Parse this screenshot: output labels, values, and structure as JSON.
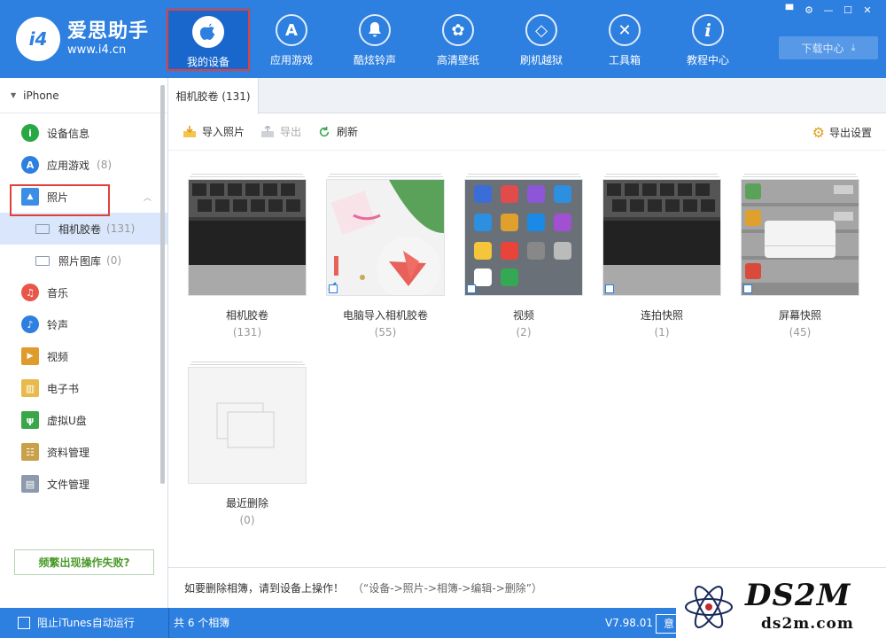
{
  "app": {
    "logo_badge": "i4",
    "logo_name": "爱思助手",
    "logo_url": "www.i4.cn"
  },
  "nav": [
    {
      "label": "我的设备",
      "icon": "apple-icon",
      "glyph": "",
      "active": true
    },
    {
      "label": "应用游戏",
      "icon": "app-store-icon",
      "glyph": "A"
    },
    {
      "label": "酷炫铃声",
      "icon": "bell-icon",
      "glyph": "♪"
    },
    {
      "label": "高清壁纸",
      "icon": "flower-icon",
      "glyph": "✿"
    },
    {
      "label": "刷机越狱",
      "icon": "dropbox-icon",
      "glyph": "◇"
    },
    {
      "label": "工具箱",
      "icon": "tools-icon",
      "glyph": "✕"
    },
    {
      "label": "教程中心",
      "icon": "info-icon",
      "glyph": "i"
    }
  ],
  "window_controls": [
    "▀",
    "⚙",
    "—",
    "☐",
    "✕"
  ],
  "download": {
    "label": "下载中心",
    "arrow": "⤓"
  },
  "sidebar": {
    "device": "iPhone",
    "items": [
      {
        "label": "设备信息",
        "icon": "info-icon",
        "glyph": "i",
        "color": "#28a745"
      },
      {
        "label": "应用游戏",
        "count": "(8)",
        "icon": "app-store-icon",
        "glyph": "A",
        "color": "#2d7fe0"
      },
      {
        "label": "照片",
        "icon": "photo-icon",
        "glyph": "▲",
        "color": "#3a8ee6",
        "collapse": "︿"
      },
      {
        "label": "音乐",
        "icon": "music-icon",
        "glyph": "♫",
        "color": "#e8564a"
      },
      {
        "label": "铃声",
        "icon": "bell-icon",
        "glyph": "♪",
        "color": "#2d7fe0"
      },
      {
        "label": "视频",
        "icon": "video-icon",
        "glyph": "▶",
        "color": "#e09b2d"
      },
      {
        "label": "电子书",
        "icon": "book-icon",
        "glyph": "▥",
        "color": "#e9b94a"
      },
      {
        "label": "虚拟U盘",
        "icon": "usb-icon",
        "glyph": "ψ",
        "color": "#3aa64a"
      },
      {
        "label": "资料管理",
        "icon": "contacts-icon",
        "glyph": "☷",
        "color": "#c9a14a"
      },
      {
        "label": "文件管理",
        "icon": "file-icon",
        "glyph": "▤",
        "color": "#8d9aab"
      }
    ],
    "subitems": [
      {
        "label": "相机胶卷",
        "count": "(131)"
      },
      {
        "label": "照片图库",
        "count": "(0)"
      }
    ],
    "help_button": "频繁出现操作失败?"
  },
  "tab": {
    "label": "相机胶卷 (131)"
  },
  "toolbar": {
    "import": "导入照片",
    "export": "导出",
    "refresh": "刷新",
    "export_settings": "导出设置"
  },
  "albums": [
    {
      "title": "相机胶卷",
      "count": "(131)",
      "thumb": "keyboard"
    },
    {
      "title": "电脑导入相机胶卷",
      "count": "(55)",
      "thumb": "watermelon"
    },
    {
      "title": "视频",
      "count": "(2)",
      "thumb": "homescreen"
    },
    {
      "title": "连拍快照",
      "count": "(1)",
      "thumb": "keyboard"
    },
    {
      "title": "屏幕快照",
      "count": "(45)",
      "thumb": "screenshot"
    },
    {
      "title": "最近删除",
      "count": "(0)",
      "thumb": "empty"
    }
  ],
  "hint": {
    "main": "如要删除相簿，请到设备上操作！",
    "sub": "（“设备->照片->相簿->编辑->删除”）"
  },
  "status": {
    "itunes": "阻止iTunes自动运行",
    "total": "共 6 个相簿",
    "version": "V7.98.01",
    "feedback": "意"
  },
  "watermark": {
    "big": "DS2M",
    "small": "ds2m.com"
  }
}
